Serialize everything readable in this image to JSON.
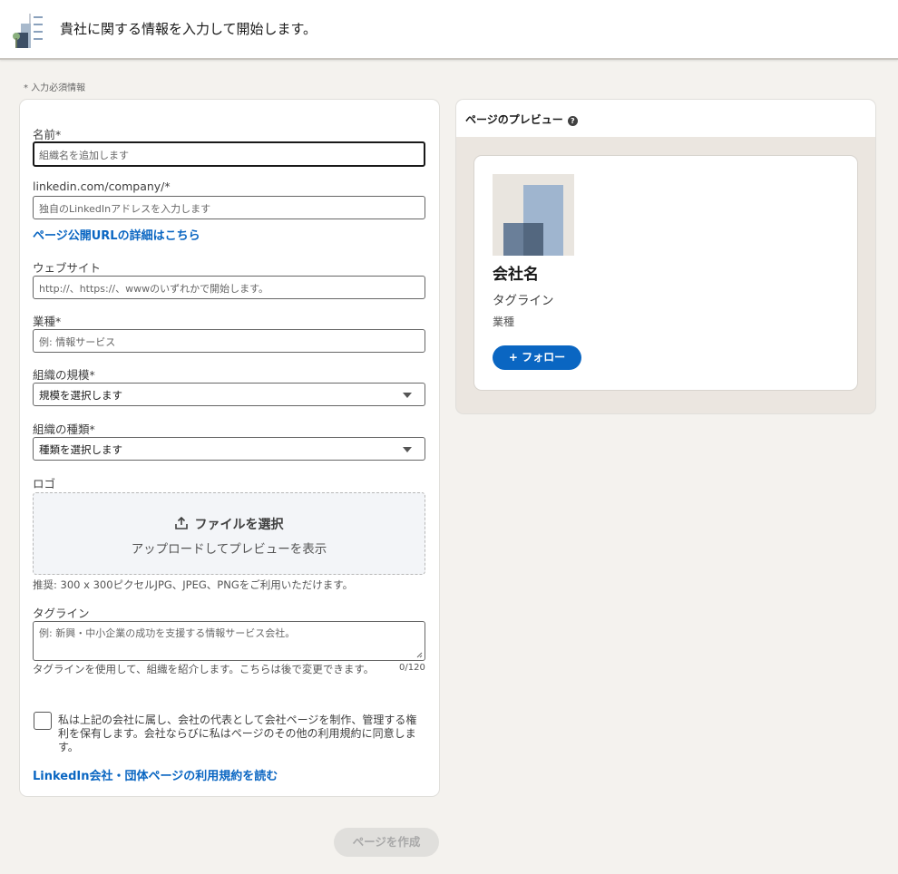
{
  "header": {
    "title": "貴社に関する情報を入力して開始します。",
    "icon": "company-building-icon"
  },
  "required_note": "* 入力必須情報",
  "form": {
    "name": {
      "label": "名前*",
      "placeholder": "組織名を追加します"
    },
    "url": {
      "label": "linkedin.com/company/*",
      "placeholder": "独自のLinkedInアドレスを入力します",
      "help_link": "ページ公開URLの詳細はこちら"
    },
    "website": {
      "label": "ウェブサイト",
      "placeholder": "http://、https://、wwwのいずれかで開始します。"
    },
    "industry": {
      "label": "業種*",
      "placeholder": "例: 情報サービス"
    },
    "size": {
      "label": "組織の規模*",
      "selected": "規模を選択します"
    },
    "type": {
      "label": "組織の種類*",
      "selected": "種類を選択します"
    },
    "logo": {
      "label": "ロゴ",
      "upload_title": "ファイルを選択",
      "upload_sub": "アップロードしてプレビューを表示",
      "hint": "推奨: 300 x 300ピクセルJPG、JPEG、PNGをご利用いただけます。"
    },
    "tagline": {
      "label": "タグライン",
      "placeholder": "例: 新興・中小企業の成功を支援する情報サービス会社。",
      "help": "タグラインを使用して、組織を紹介します。こちらは後で変更できます。",
      "counter": "0/120"
    },
    "agreement": {
      "text": "私は上記の会社に属し、会社の代表として会社ページを制作、管理する権利を保有します。会社ならびに私はページのその他の利用規約に同意します。",
      "link": "LinkedIn会社・団体ページの利用規約を読む"
    }
  },
  "preview": {
    "title": "ページのプレビュー",
    "company_name": "会社名",
    "tagline": "タグライン",
    "industry": "業種",
    "follow_label": "+ フォロー"
  },
  "create_button": "ページを作成",
  "colors": {
    "accent": "#0a66c2",
    "background": "#f4f2ee"
  }
}
